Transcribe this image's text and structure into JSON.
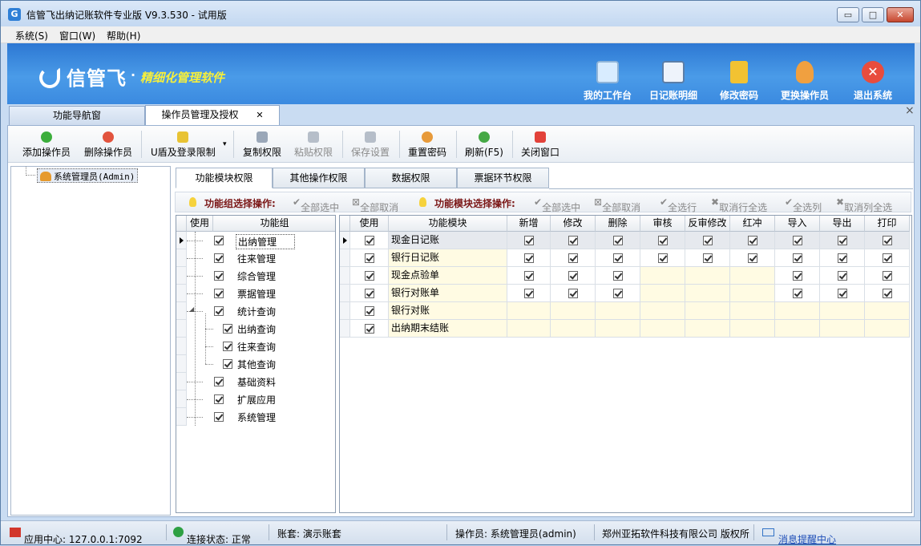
{
  "window": {
    "title": "信管飞出纳记账软件专业版 V9.3.530 - 试用版",
    "app_icon": "app-logo-icon",
    "controls": {
      "minimize": "▭",
      "maximize": "□",
      "close": "✕"
    }
  },
  "menu": [
    {
      "label": "系统(S)"
    },
    {
      "label": "窗口(W)"
    },
    {
      "label": "帮助(H)"
    }
  ],
  "banner": {
    "brand": "信管飞",
    "dot": "·",
    "slogan": "精细化管理软件",
    "buttons": [
      {
        "label": "我的工作台",
        "icon": "monitor-icon",
        "color": "#d8ecff"
      },
      {
        "label": "日记账明细",
        "icon": "ledger-icon",
        "color": "#eef3fb"
      },
      {
        "label": "修改密码",
        "icon": "lock-icon",
        "color": "#f2c232"
      },
      {
        "label": "更换操作员",
        "icon": "user-icon",
        "color": "#f0a040"
      },
      {
        "label": "退出系统",
        "icon": "exit-icon",
        "color": "#e84c3d"
      }
    ]
  },
  "tabs": [
    {
      "label": "功能导航窗",
      "active": false
    },
    {
      "label": "操作员管理及授权",
      "active": true,
      "close": "✕"
    }
  ],
  "panel_close": "×",
  "toolbar": [
    {
      "label": "添加操作员",
      "icon": "add-icon",
      "color": "#3cae3c",
      "enabled": true
    },
    {
      "label": "删除操作员",
      "icon": "delete-icon",
      "color": "#e2543e",
      "enabled": true
    },
    {
      "label": "U盾及登录限制",
      "icon": "shield-icon",
      "color": "#e8c334",
      "enabled": true,
      "dropdown": "▾"
    },
    {
      "label": "复制权限",
      "icon": "copy-icon",
      "color": "#9aa7b8",
      "enabled": true
    },
    {
      "label": "粘贴权限",
      "icon": "paste-icon",
      "color": "#b6bec9",
      "enabled": false
    },
    {
      "label": "保存设置",
      "icon": "save-icon",
      "color": "#b6bec9",
      "enabled": false
    },
    {
      "label": "重置密码",
      "icon": "reset-password-icon",
      "color": "#e79a3a",
      "enabled": true
    },
    {
      "label": "刷新(F5)",
      "icon": "refresh-icon",
      "color": "#45a845",
      "enabled": true
    },
    {
      "label": "关闭窗口",
      "icon": "close-window-icon",
      "color": "#e2423a",
      "enabled": true
    }
  ],
  "user_tree": {
    "label": "系统管理员(Admin)"
  },
  "sub_tabs": [
    {
      "label": "功能模块权限",
      "active": true
    },
    {
      "label": "其他操作权限",
      "active": false
    },
    {
      "label": "数据权限",
      "active": false
    },
    {
      "label": "票据环节权限",
      "active": false
    }
  ],
  "ops": {
    "group_label": "功能组选择操作:",
    "group_select_all": "全部选中",
    "group_deselect_all": "全部取消",
    "module_label": "功能模块选择操作:",
    "module_select_all": "全部选中",
    "module_deselect_all": "全部取消",
    "select_row": "全选行",
    "deselect_row": "取消行全选",
    "select_col": "全选列",
    "deselect_col": "取消列全选"
  },
  "group_grid": {
    "columns": [
      "使用",
      "功能组"
    ],
    "rows": [
      {
        "label": "出纳管理",
        "checked": true,
        "level": 0
      },
      {
        "label": "往来管理",
        "checked": true,
        "level": 0
      },
      {
        "label": "综合管理",
        "checked": true,
        "level": 0
      },
      {
        "label": "票据管理",
        "checked": true,
        "level": 0
      },
      {
        "label": "统计查询",
        "checked": true,
        "level": 0,
        "expanded": "◢"
      },
      {
        "label": "出纳查询",
        "checked": true,
        "level": 1
      },
      {
        "label": "往来查询",
        "checked": true,
        "level": 1
      },
      {
        "label": "其他查询",
        "checked": true,
        "level": 1
      },
      {
        "label": "基础资料",
        "checked": true,
        "level": 0
      },
      {
        "label": "扩展应用",
        "checked": true,
        "level": 0
      },
      {
        "label": "系统管理",
        "checked": true,
        "level": 0
      }
    ]
  },
  "module_grid": {
    "columns": [
      "使用",
      "功能模块",
      "新增",
      "修改",
      "删除",
      "审核",
      "反审修改",
      "红冲",
      "导入",
      "导出",
      "打印"
    ],
    "rows": [
      {
        "module": "现金日记账",
        "use": true,
        "perms": [
          true,
          true,
          true,
          true,
          true,
          true,
          true,
          true,
          true
        ]
      },
      {
        "module": "银行日记账",
        "use": true,
        "perms": [
          true,
          true,
          true,
          true,
          true,
          true,
          true,
          true,
          true
        ]
      },
      {
        "module": "现金点验单",
        "use": true,
        "perms": [
          true,
          true,
          true,
          null,
          null,
          null,
          true,
          true,
          true
        ]
      },
      {
        "module": "银行对账单",
        "use": true,
        "perms": [
          true,
          true,
          true,
          null,
          null,
          null,
          true,
          true,
          true
        ]
      },
      {
        "module": "银行对账",
        "use": true,
        "perms": [
          null,
          null,
          null,
          null,
          null,
          null,
          null,
          null,
          null
        ]
      },
      {
        "module": "出纳期末结账",
        "use": true,
        "perms": [
          null,
          null,
          null,
          null,
          null,
          null,
          null,
          null,
          null
        ]
      }
    ]
  },
  "status": {
    "app_center": "应用中心: 127.0.0.1:7092",
    "connection": "连接状态: 正常",
    "account_set": "账套: 演示账套",
    "operator": "操作员: 系统管理员(admin)",
    "company": "郑州亚拓软件科技有限公司 版权所",
    "message_center": "消息提醒中心"
  }
}
